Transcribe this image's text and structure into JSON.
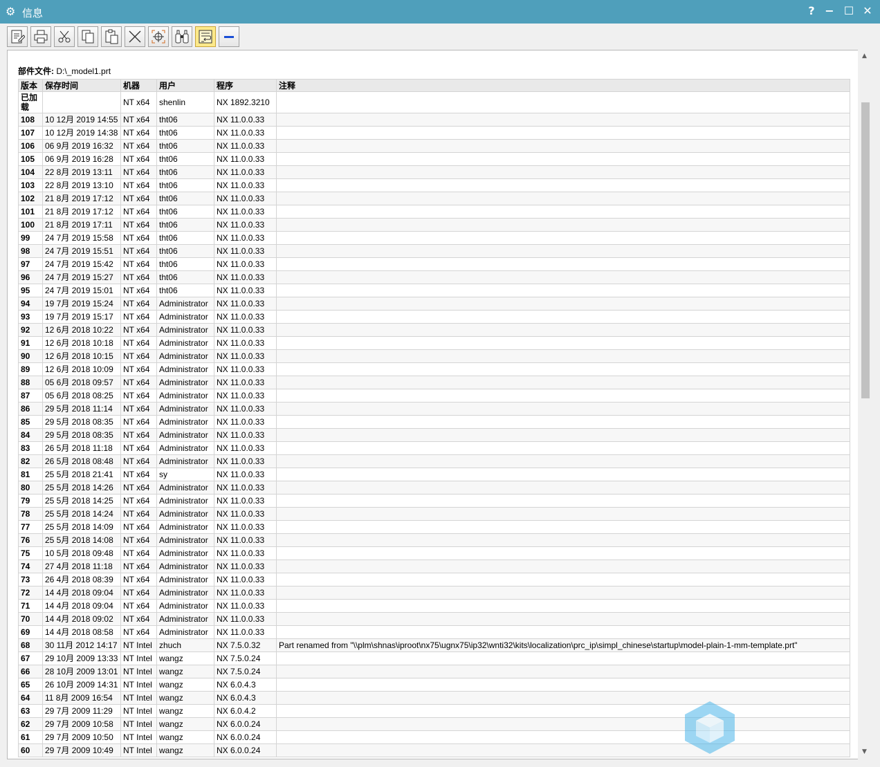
{
  "window": {
    "title": "信息",
    "help_label": "?",
    "minimize_label": "−",
    "maximize_label": "☐",
    "close_label": "✕"
  },
  "toolbar": {
    "buttons": [
      {
        "icon": "save-icon"
      },
      {
        "icon": "print-icon"
      },
      {
        "icon": "cut-icon"
      },
      {
        "icon": "copy-icon"
      },
      {
        "icon": "paste-icon"
      },
      {
        "icon": "delete-icon"
      },
      {
        "icon": "center-icon"
      },
      {
        "icon": "find-icon"
      },
      {
        "icon": "wrap-icon",
        "active": true
      },
      {
        "icon": "minus-icon"
      }
    ]
  },
  "info": {
    "part_label": "部件文件:",
    "part_path": "D:\\_model1.prt",
    "columns": [
      "版本",
      "保存时间",
      "机器",
      "用户",
      "程序",
      "注释"
    ],
    "rows": [
      [
        "已加载",
        "",
        "NT x64",
        "shenlin",
        "NX 1892.3210",
        ""
      ],
      [
        "108",
        "10 12月 2019 14:55",
        "NT x64",
        "tht06",
        "NX 11.0.0.33",
        ""
      ],
      [
        "107",
        "10 12月 2019 14:38",
        "NT x64",
        "tht06",
        "NX 11.0.0.33",
        ""
      ],
      [
        "106",
        "06 9月 2019 16:32",
        "NT x64",
        "tht06",
        "NX 11.0.0.33",
        ""
      ],
      [
        "105",
        "06 9月 2019 16:28",
        "NT x64",
        "tht06",
        "NX 11.0.0.33",
        ""
      ],
      [
        "104",
        "22 8月 2019 13:11",
        "NT x64",
        "tht06",
        "NX 11.0.0.33",
        ""
      ],
      [
        "103",
        "22 8月 2019 13:10",
        "NT x64",
        "tht06",
        "NX 11.0.0.33",
        ""
      ],
      [
        "102",
        "21 8月 2019 17:12",
        "NT x64",
        "tht06",
        "NX 11.0.0.33",
        ""
      ],
      [
        "101",
        "21 8月 2019 17:12",
        "NT x64",
        "tht06",
        "NX 11.0.0.33",
        ""
      ],
      [
        "100",
        "21 8月 2019 17:11",
        "NT x64",
        "tht06",
        "NX 11.0.0.33",
        ""
      ],
      [
        "99",
        "24 7月 2019 15:58",
        "NT x64",
        "tht06",
        "NX 11.0.0.33",
        ""
      ],
      [
        "98",
        "24 7月 2019 15:51",
        "NT x64",
        "tht06",
        "NX 11.0.0.33",
        ""
      ],
      [
        "97",
        "24 7月 2019 15:42",
        "NT x64",
        "tht06",
        "NX 11.0.0.33",
        ""
      ],
      [
        "96",
        "24 7月 2019 15:27",
        "NT x64",
        "tht06",
        "NX 11.0.0.33",
        ""
      ],
      [
        "95",
        "24 7月 2019 15:01",
        "NT x64",
        "tht06",
        "NX 11.0.0.33",
        ""
      ],
      [
        "94",
        "19 7月 2019 15:24",
        "NT x64",
        "Administrator",
        "NX 11.0.0.33",
        ""
      ],
      [
        "93",
        "19 7月 2019 15:17",
        "NT x64",
        "Administrator",
        "NX 11.0.0.33",
        ""
      ],
      [
        "92",
        "12 6月 2018 10:22",
        "NT x64",
        "Administrator",
        "NX 11.0.0.33",
        ""
      ],
      [
        "91",
        "12 6月 2018 10:18",
        "NT x64",
        "Administrator",
        "NX 11.0.0.33",
        ""
      ],
      [
        "90",
        "12 6月 2018 10:15",
        "NT x64",
        "Administrator",
        "NX 11.0.0.33",
        ""
      ],
      [
        "89",
        "12 6月 2018 10:09",
        "NT x64",
        "Administrator",
        "NX 11.0.0.33",
        ""
      ],
      [
        "88",
        "05 6月 2018 09:57",
        "NT x64",
        "Administrator",
        "NX 11.0.0.33",
        ""
      ],
      [
        "87",
        "05 6月 2018 08:25",
        "NT x64",
        "Administrator",
        "NX 11.0.0.33",
        ""
      ],
      [
        "86",
        "29 5月 2018 11:14",
        "NT x64",
        "Administrator",
        "NX 11.0.0.33",
        ""
      ],
      [
        "85",
        "29 5月 2018 08:35",
        "NT x64",
        "Administrator",
        "NX 11.0.0.33",
        ""
      ],
      [
        "84",
        "29 5月 2018 08:35",
        "NT x64",
        "Administrator",
        "NX 11.0.0.33",
        ""
      ],
      [
        "83",
        "26 5月 2018 11:18",
        "NT x64",
        "Administrator",
        "NX 11.0.0.33",
        ""
      ],
      [
        "82",
        "26 5月 2018 08:48",
        "NT x64",
        "Administrator",
        "NX 11.0.0.33",
        ""
      ],
      [
        "81",
        "25 5月 2018 21:41",
        "NT x64",
        "sy",
        "NX 11.0.0.33",
        ""
      ],
      [
        "80",
        "25 5月 2018 14:26",
        "NT x64",
        "Administrator",
        "NX 11.0.0.33",
        ""
      ],
      [
        "79",
        "25 5月 2018 14:25",
        "NT x64",
        "Administrator",
        "NX 11.0.0.33",
        ""
      ],
      [
        "78",
        "25 5月 2018 14:24",
        "NT x64",
        "Administrator",
        "NX 11.0.0.33",
        ""
      ],
      [
        "77",
        "25 5月 2018 14:09",
        "NT x64",
        "Administrator",
        "NX 11.0.0.33",
        ""
      ],
      [
        "76",
        "25 5月 2018 14:08",
        "NT x64",
        "Administrator",
        "NX 11.0.0.33",
        ""
      ],
      [
        "75",
        "10 5月 2018 09:48",
        "NT x64",
        "Administrator",
        "NX 11.0.0.33",
        ""
      ],
      [
        "74",
        "27 4月 2018 11:18",
        "NT x64",
        "Administrator",
        "NX 11.0.0.33",
        ""
      ],
      [
        "73",
        "26 4月 2018 08:39",
        "NT x64",
        "Administrator",
        "NX 11.0.0.33",
        ""
      ],
      [
        "72",
        "14 4月 2018 09:04",
        "NT x64",
        "Administrator",
        "NX 11.0.0.33",
        ""
      ],
      [
        "71",
        "14 4月 2018 09:04",
        "NT x64",
        "Administrator",
        "NX 11.0.0.33",
        ""
      ],
      [
        "70",
        "14 4月 2018 09:02",
        "NT x64",
        "Administrator",
        "NX 11.0.0.33",
        ""
      ],
      [
        "69",
        "14 4月 2018 08:58",
        "NT x64",
        "Administrator",
        "NX 11.0.0.33",
        ""
      ],
      [
        "68",
        "30 11月 2012 14:17",
        "NT Intel",
        "zhuch",
        "NX 7.5.0.32",
        "Part renamed from \"\\\\plm\\shnas\\iproot\\nx75\\ugnx75\\ip32\\wnti32\\kits\\localization\\prc_ip\\simpl_chinese\\startup\\model-plain-1-mm-template.prt\""
      ],
      [
        "67",
        "29 10月 2009 13:33",
        "NT Intel",
        "wangz",
        "NX 7.5.0.24",
        ""
      ],
      [
        "66",
        "28 10月 2009 13:01",
        "NT Intel",
        "wangz",
        "NX 7.5.0.24",
        ""
      ],
      [
        "65",
        "26 10月 2009 14:31",
        "NT Intel",
        "wangz",
        "NX 6.0.4.3",
        ""
      ],
      [
        "64",
        "11 8月 2009 16:54",
        "NT Intel",
        "wangz",
        "NX 6.0.4.3",
        ""
      ],
      [
        "63",
        "29 7月 2009 11:29",
        "NT Intel",
        "wangz",
        "NX 6.0.4.2",
        ""
      ],
      [
        "62",
        "29 7月 2009 10:58",
        "NT Intel",
        "wangz",
        "NX 6.0.0.24",
        ""
      ],
      [
        "61",
        "29 7月 2009 10:50",
        "NT Intel",
        "wangz",
        "NX 6.0.0.24",
        ""
      ],
      [
        "60",
        "29 7月 2009 10:49",
        "NT Intel",
        "wangz",
        "NX 6.0.0.24",
        ""
      ]
    ]
  }
}
